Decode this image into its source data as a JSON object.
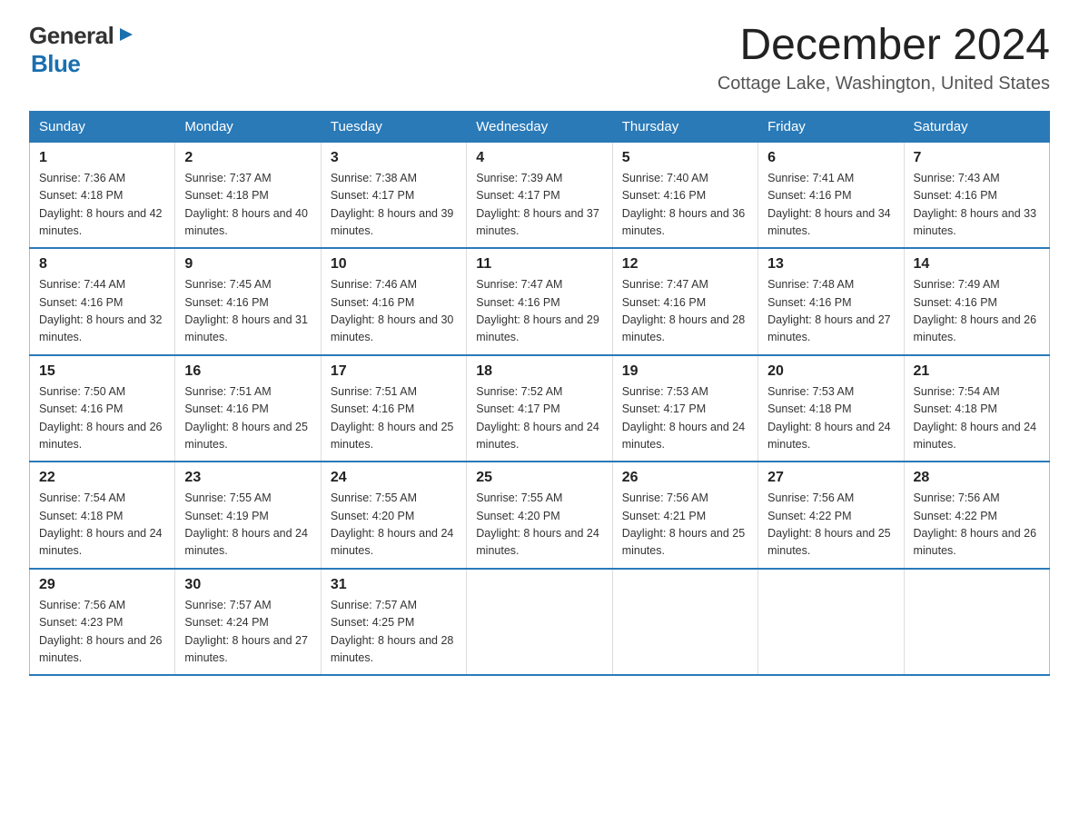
{
  "logo": {
    "line1": "General",
    "arrow": "▶",
    "line2": "Blue"
  },
  "header": {
    "month": "December 2024",
    "location": "Cottage Lake, Washington, United States"
  },
  "weekdays": [
    "Sunday",
    "Monday",
    "Tuesday",
    "Wednesday",
    "Thursday",
    "Friday",
    "Saturday"
  ],
  "weeks": [
    [
      {
        "day": "1",
        "sunrise": "7:36 AM",
        "sunset": "4:18 PM",
        "daylight": "8 hours and 42 minutes."
      },
      {
        "day": "2",
        "sunrise": "7:37 AM",
        "sunset": "4:18 PM",
        "daylight": "8 hours and 40 minutes."
      },
      {
        "day": "3",
        "sunrise": "7:38 AM",
        "sunset": "4:17 PM",
        "daylight": "8 hours and 39 minutes."
      },
      {
        "day": "4",
        "sunrise": "7:39 AM",
        "sunset": "4:17 PM",
        "daylight": "8 hours and 37 minutes."
      },
      {
        "day": "5",
        "sunrise": "7:40 AM",
        "sunset": "4:16 PM",
        "daylight": "8 hours and 36 minutes."
      },
      {
        "day": "6",
        "sunrise": "7:41 AM",
        "sunset": "4:16 PM",
        "daylight": "8 hours and 34 minutes."
      },
      {
        "day": "7",
        "sunrise": "7:43 AM",
        "sunset": "4:16 PM",
        "daylight": "8 hours and 33 minutes."
      }
    ],
    [
      {
        "day": "8",
        "sunrise": "7:44 AM",
        "sunset": "4:16 PM",
        "daylight": "8 hours and 32 minutes."
      },
      {
        "day": "9",
        "sunrise": "7:45 AM",
        "sunset": "4:16 PM",
        "daylight": "8 hours and 31 minutes."
      },
      {
        "day": "10",
        "sunrise": "7:46 AM",
        "sunset": "4:16 PM",
        "daylight": "8 hours and 30 minutes."
      },
      {
        "day": "11",
        "sunrise": "7:47 AM",
        "sunset": "4:16 PM",
        "daylight": "8 hours and 29 minutes."
      },
      {
        "day": "12",
        "sunrise": "7:47 AM",
        "sunset": "4:16 PM",
        "daylight": "8 hours and 28 minutes."
      },
      {
        "day": "13",
        "sunrise": "7:48 AM",
        "sunset": "4:16 PM",
        "daylight": "8 hours and 27 minutes."
      },
      {
        "day": "14",
        "sunrise": "7:49 AM",
        "sunset": "4:16 PM",
        "daylight": "8 hours and 26 minutes."
      }
    ],
    [
      {
        "day": "15",
        "sunrise": "7:50 AM",
        "sunset": "4:16 PM",
        "daylight": "8 hours and 26 minutes."
      },
      {
        "day": "16",
        "sunrise": "7:51 AM",
        "sunset": "4:16 PM",
        "daylight": "8 hours and 25 minutes."
      },
      {
        "day": "17",
        "sunrise": "7:51 AM",
        "sunset": "4:16 PM",
        "daylight": "8 hours and 25 minutes."
      },
      {
        "day": "18",
        "sunrise": "7:52 AM",
        "sunset": "4:17 PM",
        "daylight": "8 hours and 24 minutes."
      },
      {
        "day": "19",
        "sunrise": "7:53 AM",
        "sunset": "4:17 PM",
        "daylight": "8 hours and 24 minutes."
      },
      {
        "day": "20",
        "sunrise": "7:53 AM",
        "sunset": "4:18 PM",
        "daylight": "8 hours and 24 minutes."
      },
      {
        "day": "21",
        "sunrise": "7:54 AM",
        "sunset": "4:18 PM",
        "daylight": "8 hours and 24 minutes."
      }
    ],
    [
      {
        "day": "22",
        "sunrise": "7:54 AM",
        "sunset": "4:18 PM",
        "daylight": "8 hours and 24 minutes."
      },
      {
        "day": "23",
        "sunrise": "7:55 AM",
        "sunset": "4:19 PM",
        "daylight": "8 hours and 24 minutes."
      },
      {
        "day": "24",
        "sunrise": "7:55 AM",
        "sunset": "4:20 PM",
        "daylight": "8 hours and 24 minutes."
      },
      {
        "day": "25",
        "sunrise": "7:55 AM",
        "sunset": "4:20 PM",
        "daylight": "8 hours and 24 minutes."
      },
      {
        "day": "26",
        "sunrise": "7:56 AM",
        "sunset": "4:21 PM",
        "daylight": "8 hours and 25 minutes."
      },
      {
        "day": "27",
        "sunrise": "7:56 AM",
        "sunset": "4:22 PM",
        "daylight": "8 hours and 25 minutes."
      },
      {
        "day": "28",
        "sunrise": "7:56 AM",
        "sunset": "4:22 PM",
        "daylight": "8 hours and 26 minutes."
      }
    ],
    [
      {
        "day": "29",
        "sunrise": "7:56 AM",
        "sunset": "4:23 PM",
        "daylight": "8 hours and 26 minutes."
      },
      {
        "day": "30",
        "sunrise": "7:57 AM",
        "sunset": "4:24 PM",
        "daylight": "8 hours and 27 minutes."
      },
      {
        "day": "31",
        "sunrise": "7:57 AM",
        "sunset": "4:25 PM",
        "daylight": "8 hours and 28 minutes."
      },
      null,
      null,
      null,
      null
    ]
  ]
}
